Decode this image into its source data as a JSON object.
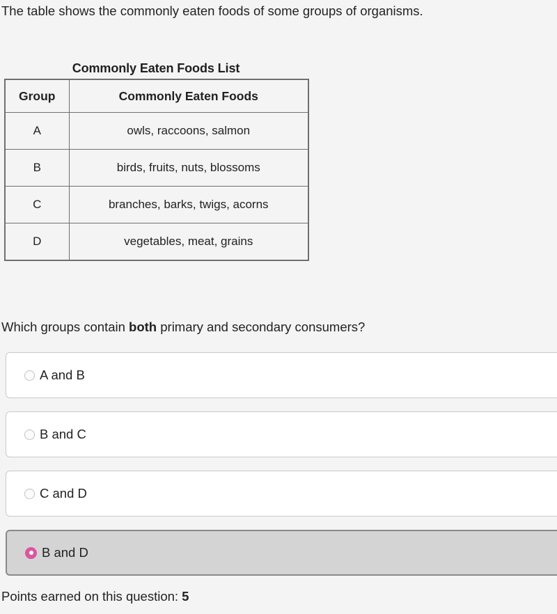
{
  "intro": {
    "text": "The table shows the commonly eaten foods of some groups of organisms."
  },
  "table": {
    "caption": "Commonly Eaten Foods List",
    "headers": [
      "Group",
      "Commonly Eaten Foods"
    ],
    "rows": [
      [
        "A",
        "owls, raccoons, salmon"
      ],
      [
        "B",
        "birds, fruits, nuts, blossoms"
      ],
      [
        "C",
        "branches, barks, twigs, acorns"
      ],
      [
        "D",
        "vegetables, meat, grains"
      ]
    ]
  },
  "question": {
    "prefix": "Which groups contain ",
    "emphasis": "both",
    "suffix": " primary and secondary consumers?"
  },
  "choices": [
    {
      "label": "A and B",
      "selected": false,
      "radio_icon": "radio-unchecked-icon"
    },
    {
      "label": "B and C",
      "selected": false,
      "radio_icon": "radio-unchecked-icon"
    },
    {
      "label": "C and D",
      "selected": false,
      "radio_icon": "radio-unchecked-icon"
    },
    {
      "label": "B and D",
      "selected": true,
      "radio_icon": "radio-checked-icon"
    }
  ],
  "footer": {
    "points_prefix": "Points earned on this question: ",
    "points_value": "5"
  },
  "colors": {
    "page_background": "#f4f4f4",
    "selected_fill": "#d4d4d4",
    "selected_radio": "#db56a0",
    "table_border": "#6f6f6f",
    "choice_border": "#c9c9c9",
    "text": "#222222"
  }
}
